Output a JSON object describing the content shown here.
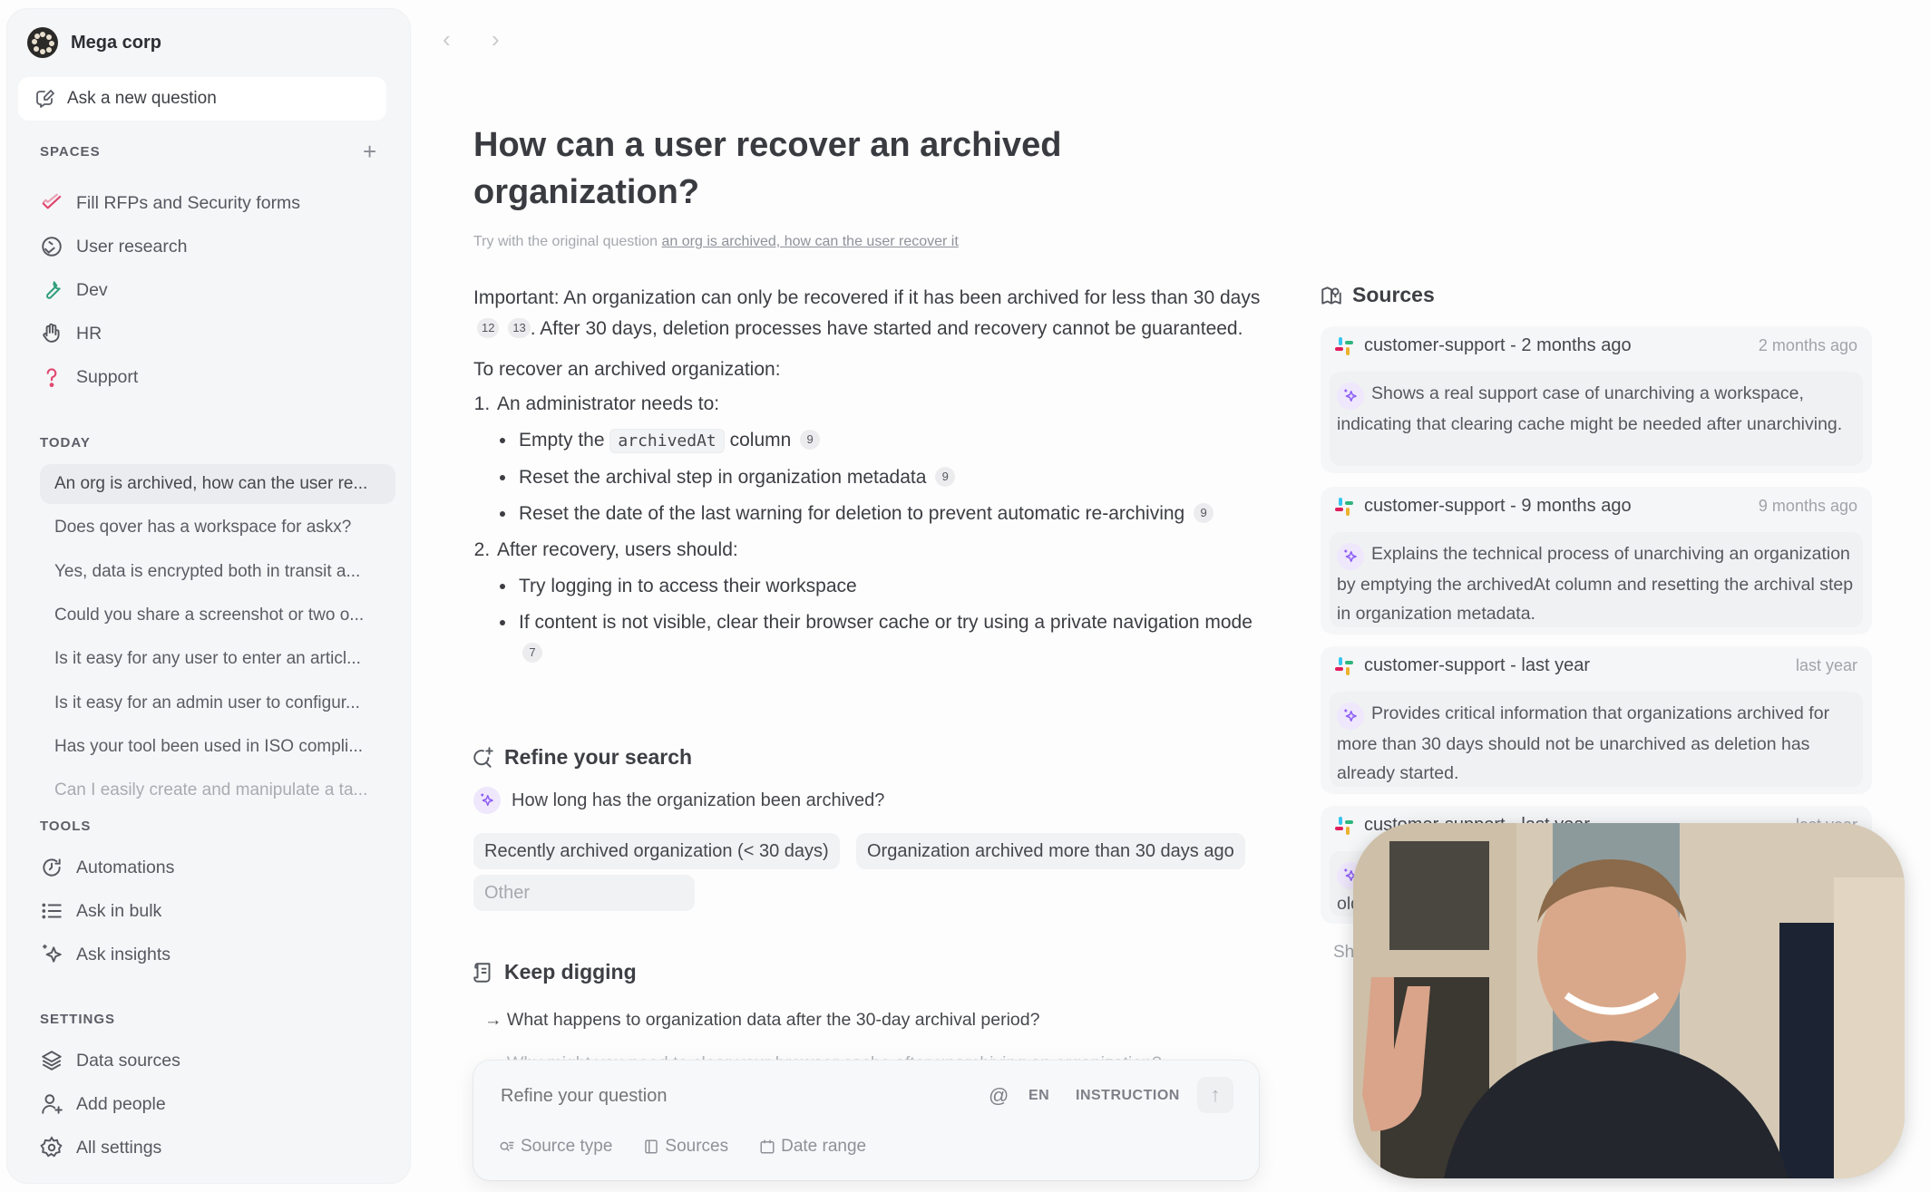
{
  "sidebar": {
    "brand_name": "Mega corp",
    "ask_button": "Ask a new question",
    "spaces_label": "SPACES",
    "spaces": [
      {
        "label": "Fill RFPs and Security forms",
        "icon": "check-icon",
        "color": "#e0476f"
      },
      {
        "label": "User research",
        "icon": "globe-hands-icon",
        "color": "#55585f"
      },
      {
        "label": "Dev",
        "icon": "wrench-icon",
        "color": "#2f9e7a"
      },
      {
        "label": "HR",
        "icon": "wave-hand-icon",
        "color": "#55585f"
      },
      {
        "label": "Support",
        "icon": "question-icon",
        "color": "#e0476f"
      }
    ],
    "today_label": "TODAY",
    "history": [
      "An org is archived, how can the user re...",
      "Does qover has a workspace for askx?",
      "Yes, data is encrypted both in transit a...",
      "Could you share a screenshot or two o...",
      "Is it easy for any user to enter an articl...",
      "Is it easy for an admin user to configur...",
      "Has your tool been used in ISO compli...",
      "Can I easily create and manipulate a ta..."
    ],
    "tools_label": "TOOLS",
    "tools": [
      {
        "label": "Automations",
        "icon": "clock-refresh-icon"
      },
      {
        "label": "Ask in bulk",
        "icon": "list-icon"
      },
      {
        "label": "Ask insights",
        "icon": "sparkle-icon"
      }
    ],
    "settings_label": "SETTINGS",
    "settings": [
      {
        "label": "Data sources",
        "icon": "layers-icon"
      },
      {
        "label": "Add people",
        "icon": "user-plus-icon"
      },
      {
        "label": "All settings",
        "icon": "gear-icon"
      }
    ]
  },
  "main": {
    "title": "How can a user recover an archived organization?",
    "original_prefix": "Try with the original question",
    "original_link": "an org is archived, how can the user recover it",
    "answer": {
      "p1_a": "Important: An organization can only be recovered if it has been archived for less than 30 days",
      "p1_cites": [
        "12",
        "13"
      ],
      "p1_b": ". After 30 days, deletion processes have started and recovery cannot be guaranteed.",
      "p2": "To recover an archived organization:",
      "step1": "An administrator needs to:",
      "step1_items": [
        {
          "before": "Empty the",
          "code": "archivedAt",
          "after": "column",
          "cite": "9"
        },
        {
          "text": "Reset the archival step in organization metadata",
          "cite": "9"
        },
        {
          "text": "Reset the date of the last warning for deletion to prevent automatic re-archiving",
          "cite": "9"
        }
      ],
      "step2": "After recovery, users should:",
      "step2_items": [
        {
          "text": "Try logging in to access their workspace"
        },
        {
          "text": "If content is not visible, clear their browser cache or try using a private navigation mode",
          "cite": "7"
        }
      ]
    },
    "refine": {
      "heading": "Refine your search",
      "question": "How long has the organization been archived?",
      "options": [
        "Recently archived organization (< 30 days)",
        "Organization archived more than 30 days ago"
      ],
      "other": "Other"
    },
    "keep_digging": {
      "heading": "Keep digging",
      "items": [
        "What happens to organization data after the 30-day archival period?",
        "Why might you need to clear your browser cache after unarchiving an organization?"
      ]
    },
    "input": {
      "placeholder": "Refine your question",
      "mention": "@",
      "language": "EN",
      "instruction": "INSTRUCTION",
      "filters": [
        "Source type",
        "Sources",
        "Date range"
      ]
    }
  },
  "sources": {
    "heading": "Sources",
    "cards": [
      {
        "title": "customer-support - 2 months ago",
        "when": "2 months ago",
        "summary": "Shows a real support case of unarchiving a workspace, indicating that clearing cache might be needed after unarchiving."
      },
      {
        "title": "customer-support - 9 months ago",
        "when": "9 months ago",
        "summary": "Explains the technical process of unarchiving an organization by emptying the archivedAt column and resetting the archival step in organization metadata."
      },
      {
        "title": "customer-support - last year",
        "when": "last year",
        "summary": "Provides critical information that organizations archived for more than 30 days should not be unarchived as deletion has already started."
      },
      {
        "title": "customer-support - last year",
        "when": "last year",
        "summary": "old"
      }
    ],
    "show_more": "Sh"
  },
  "colors": {
    "accent_purple": "#8b5cf6",
    "sidebar_bg": "#f5f6f8",
    "pink": "#e0476f",
    "green": "#2f9e7a"
  }
}
